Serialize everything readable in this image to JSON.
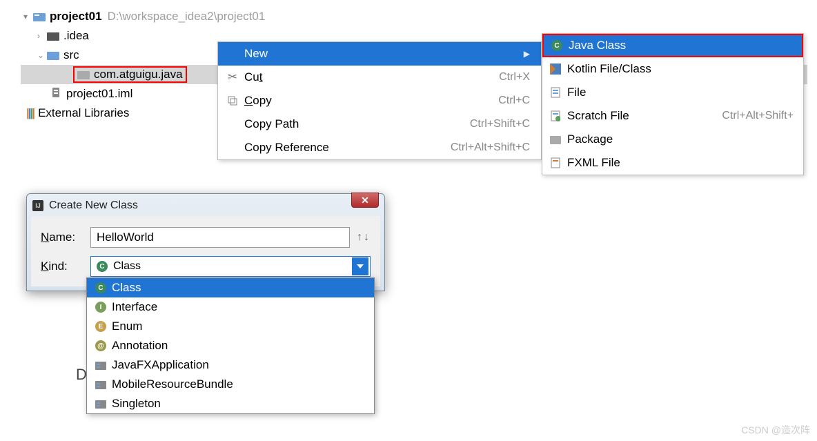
{
  "tree": {
    "project": {
      "name": "project01",
      "path": "D:\\workspace_idea2\\project01"
    },
    "idea": ".idea",
    "src": "src",
    "pkg": "com.atguigu.java",
    "iml": "project01.iml",
    "extlib": "External Libraries"
  },
  "ctx": {
    "new": "New",
    "cut": {
      "label_pre": "Cu",
      "label_u": "t",
      "shortcut": "Ctrl+X"
    },
    "copy": {
      "label_u": "C",
      "label_post": "opy",
      "shortcut": "Ctrl+C"
    },
    "copypath": {
      "label": "Copy Path",
      "shortcut": "Ctrl+Shift+C"
    },
    "copyref": {
      "label": "Copy Reference",
      "shortcut": "Ctrl+Alt+Shift+C"
    }
  },
  "submenu": {
    "javaclass": "Java Class",
    "kotlin": "Kotlin File/Class",
    "file": "File",
    "scratch": {
      "label": "Scratch File",
      "shortcut": "Ctrl+Alt+Shift+"
    },
    "package": "Package",
    "fxml": "FXML File"
  },
  "dialog": {
    "title": "Create New Class",
    "name_label_u": "N",
    "name_label_post": "ame:",
    "name_value": "HelloWorld",
    "kind_label_u": "K",
    "kind_label_post": "ind:",
    "kind_value": "Class"
  },
  "dropdown": {
    "items": [
      {
        "icon": "c",
        "label": "Class",
        "hl": true
      },
      {
        "icon": "i",
        "label": "Interface"
      },
      {
        "icon": "e",
        "label": "Enum"
      },
      {
        "icon": "a",
        "label": "Annotation"
      },
      {
        "icon": "tpl",
        "label": "JavaFXApplication"
      },
      {
        "icon": "tpl",
        "label": "MobileResourceBundle"
      },
      {
        "icon": "tpl",
        "label": "Singleton"
      }
    ]
  },
  "big_d": "D",
  "watermark": "CSDN @造次阵"
}
